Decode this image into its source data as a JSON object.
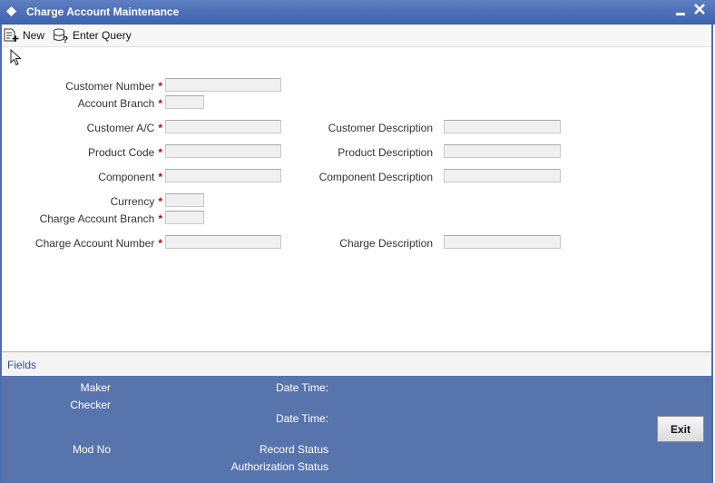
{
  "window": {
    "title": "Charge Account Maintenance"
  },
  "toolbar": {
    "new_label": "New",
    "enter_query_label": "Enter Query"
  },
  "form": {
    "customer_number": {
      "label": "Customer Number",
      "value": ""
    },
    "account_branch": {
      "label": "Account Branch",
      "value": ""
    },
    "customer_ac": {
      "label": "Customer A/C",
      "value": ""
    },
    "customer_description": {
      "label": "Customer Description",
      "value": ""
    },
    "product_code": {
      "label": "Product Code",
      "value": ""
    },
    "product_description": {
      "label": "Product Description",
      "value": ""
    },
    "component": {
      "label": "Component",
      "value": ""
    },
    "component_description": {
      "label": "Component Description",
      "value": ""
    },
    "currency": {
      "label": "Currency",
      "value": ""
    },
    "charge_account_branch": {
      "label": "Charge Account Branch",
      "value": ""
    },
    "charge_account_number": {
      "label": "Charge Account Number",
      "value": ""
    },
    "charge_description": {
      "label": "Charge Description",
      "value": ""
    },
    "required_mark": "*"
  },
  "fields_bar": {
    "label": "Fields"
  },
  "footer": {
    "maker_label": "Maker",
    "checker_label": "Checker",
    "date_time_label_1": "Date Time:",
    "date_time_label_2": "Date Time:",
    "mod_no_label": "Mod No",
    "record_status_label": "Record Status",
    "authorization_status_label": "Authorization Status",
    "exit_label": "Exit"
  }
}
